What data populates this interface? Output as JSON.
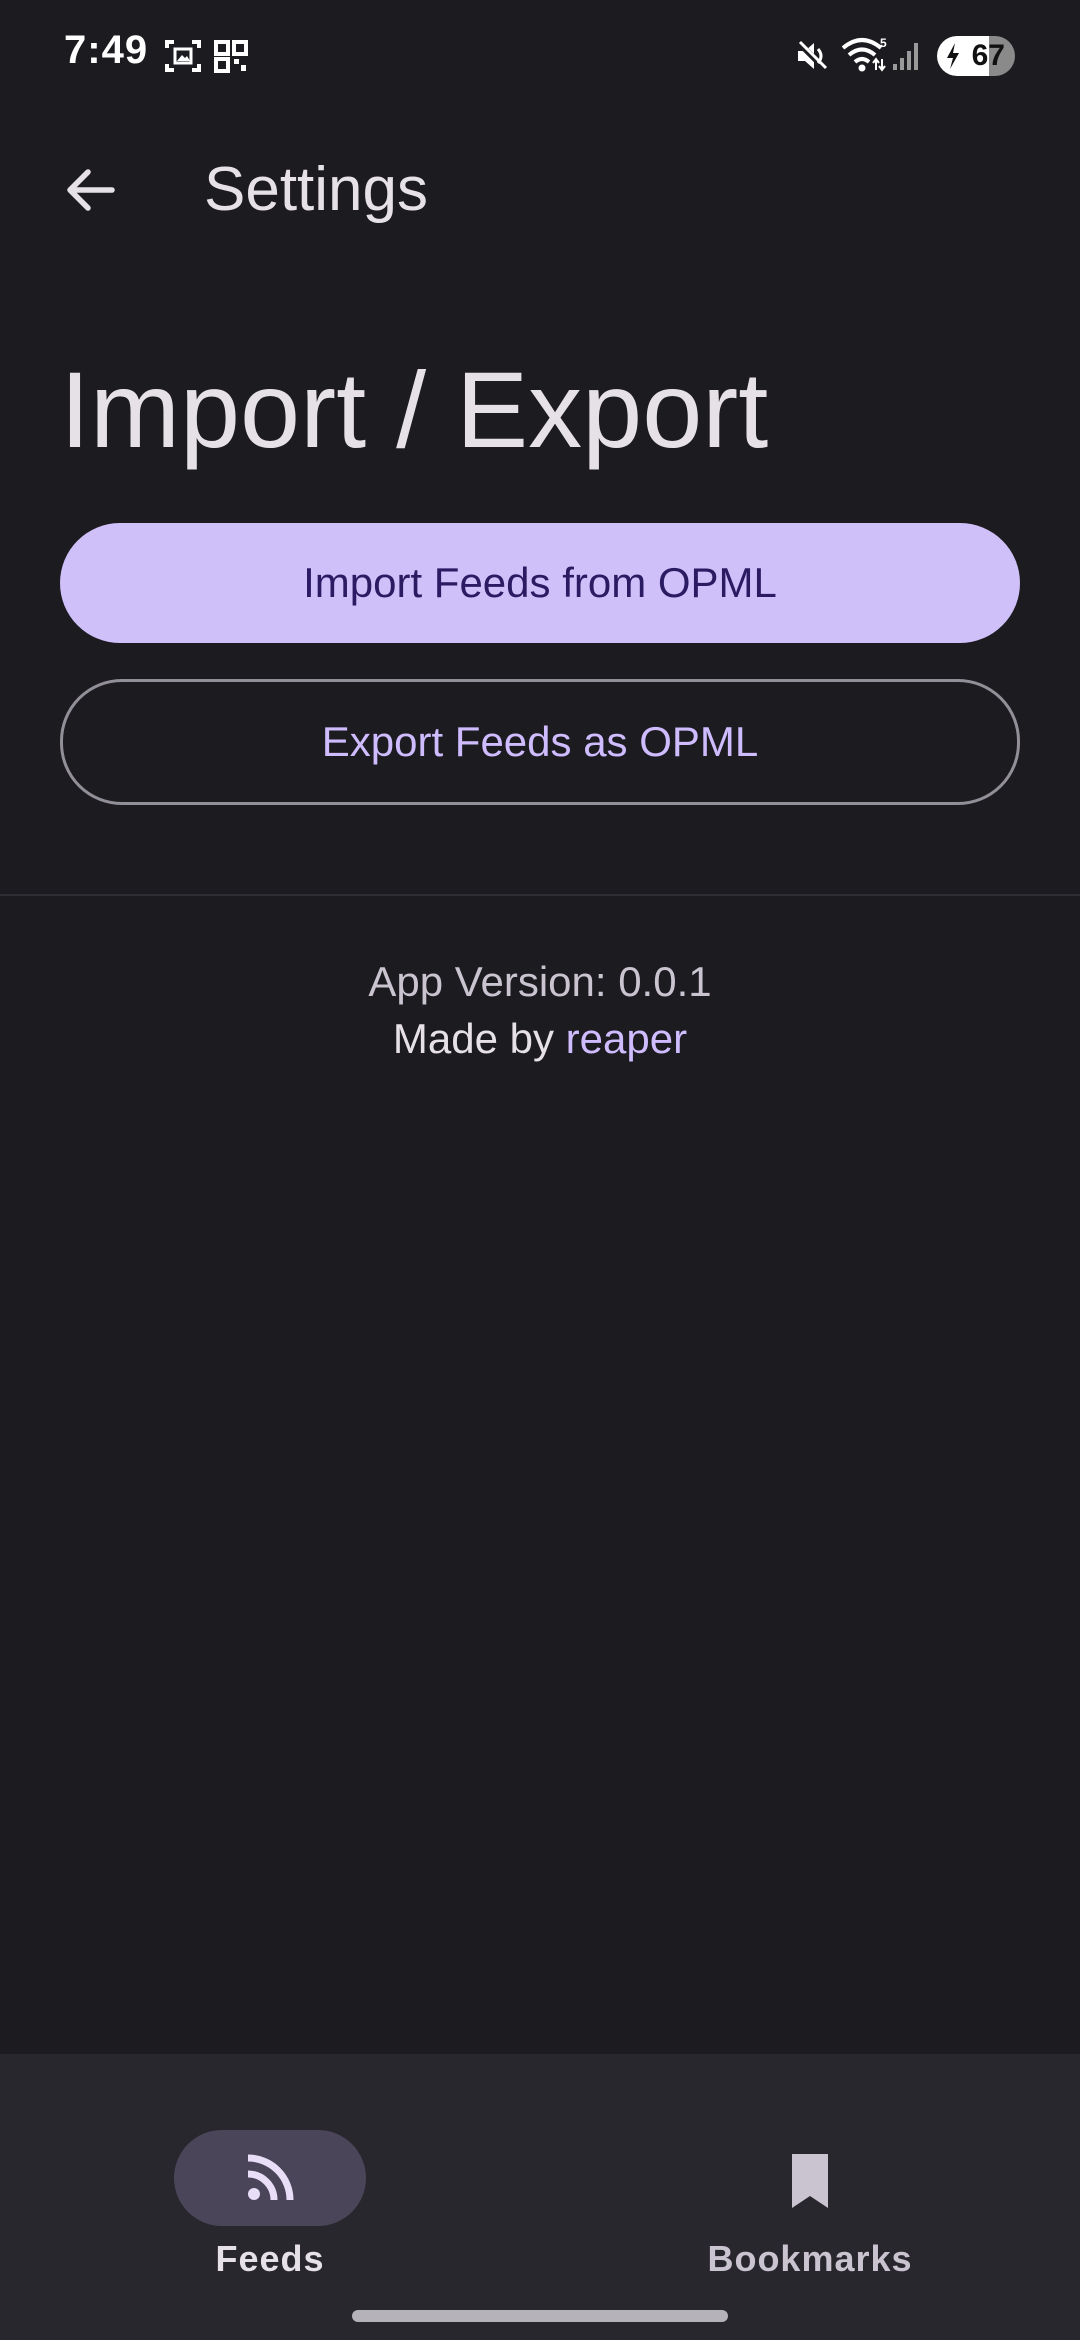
{
  "status_bar": {
    "time": "7:49",
    "battery_level": "67",
    "battery_fraction": 0.67,
    "wifi_badge": "5",
    "icons": [
      "screenshot-icon",
      "qr-scan-icon",
      "mute-icon",
      "wifi-icon",
      "signal-icon",
      "battery-icon"
    ]
  },
  "top_bar": {
    "title": "Settings",
    "back_icon": "arrow-back-icon"
  },
  "section": {
    "title": "Import / Export"
  },
  "buttons": {
    "import_label": "Import Feeds from OPML",
    "export_label": "Export Feeds as OPML"
  },
  "about": {
    "version_text": "App Version: 0.0.1",
    "made_by_prefix": "Made by",
    "author": "reaper"
  },
  "bottom_nav": {
    "items": [
      {
        "label": "Feeds",
        "icon": "rss-icon",
        "selected": true
      },
      {
        "label": "Bookmarks",
        "icon": "bookmark-icon",
        "selected": false
      }
    ]
  },
  "colors": {
    "background": "#1c1b20",
    "primary": "#cfc0f9",
    "on_primary": "#2a1b63",
    "accent_text": "#cfbcff",
    "nav_background": "#29272e",
    "nav_selected_pill": "#4a4558"
  }
}
